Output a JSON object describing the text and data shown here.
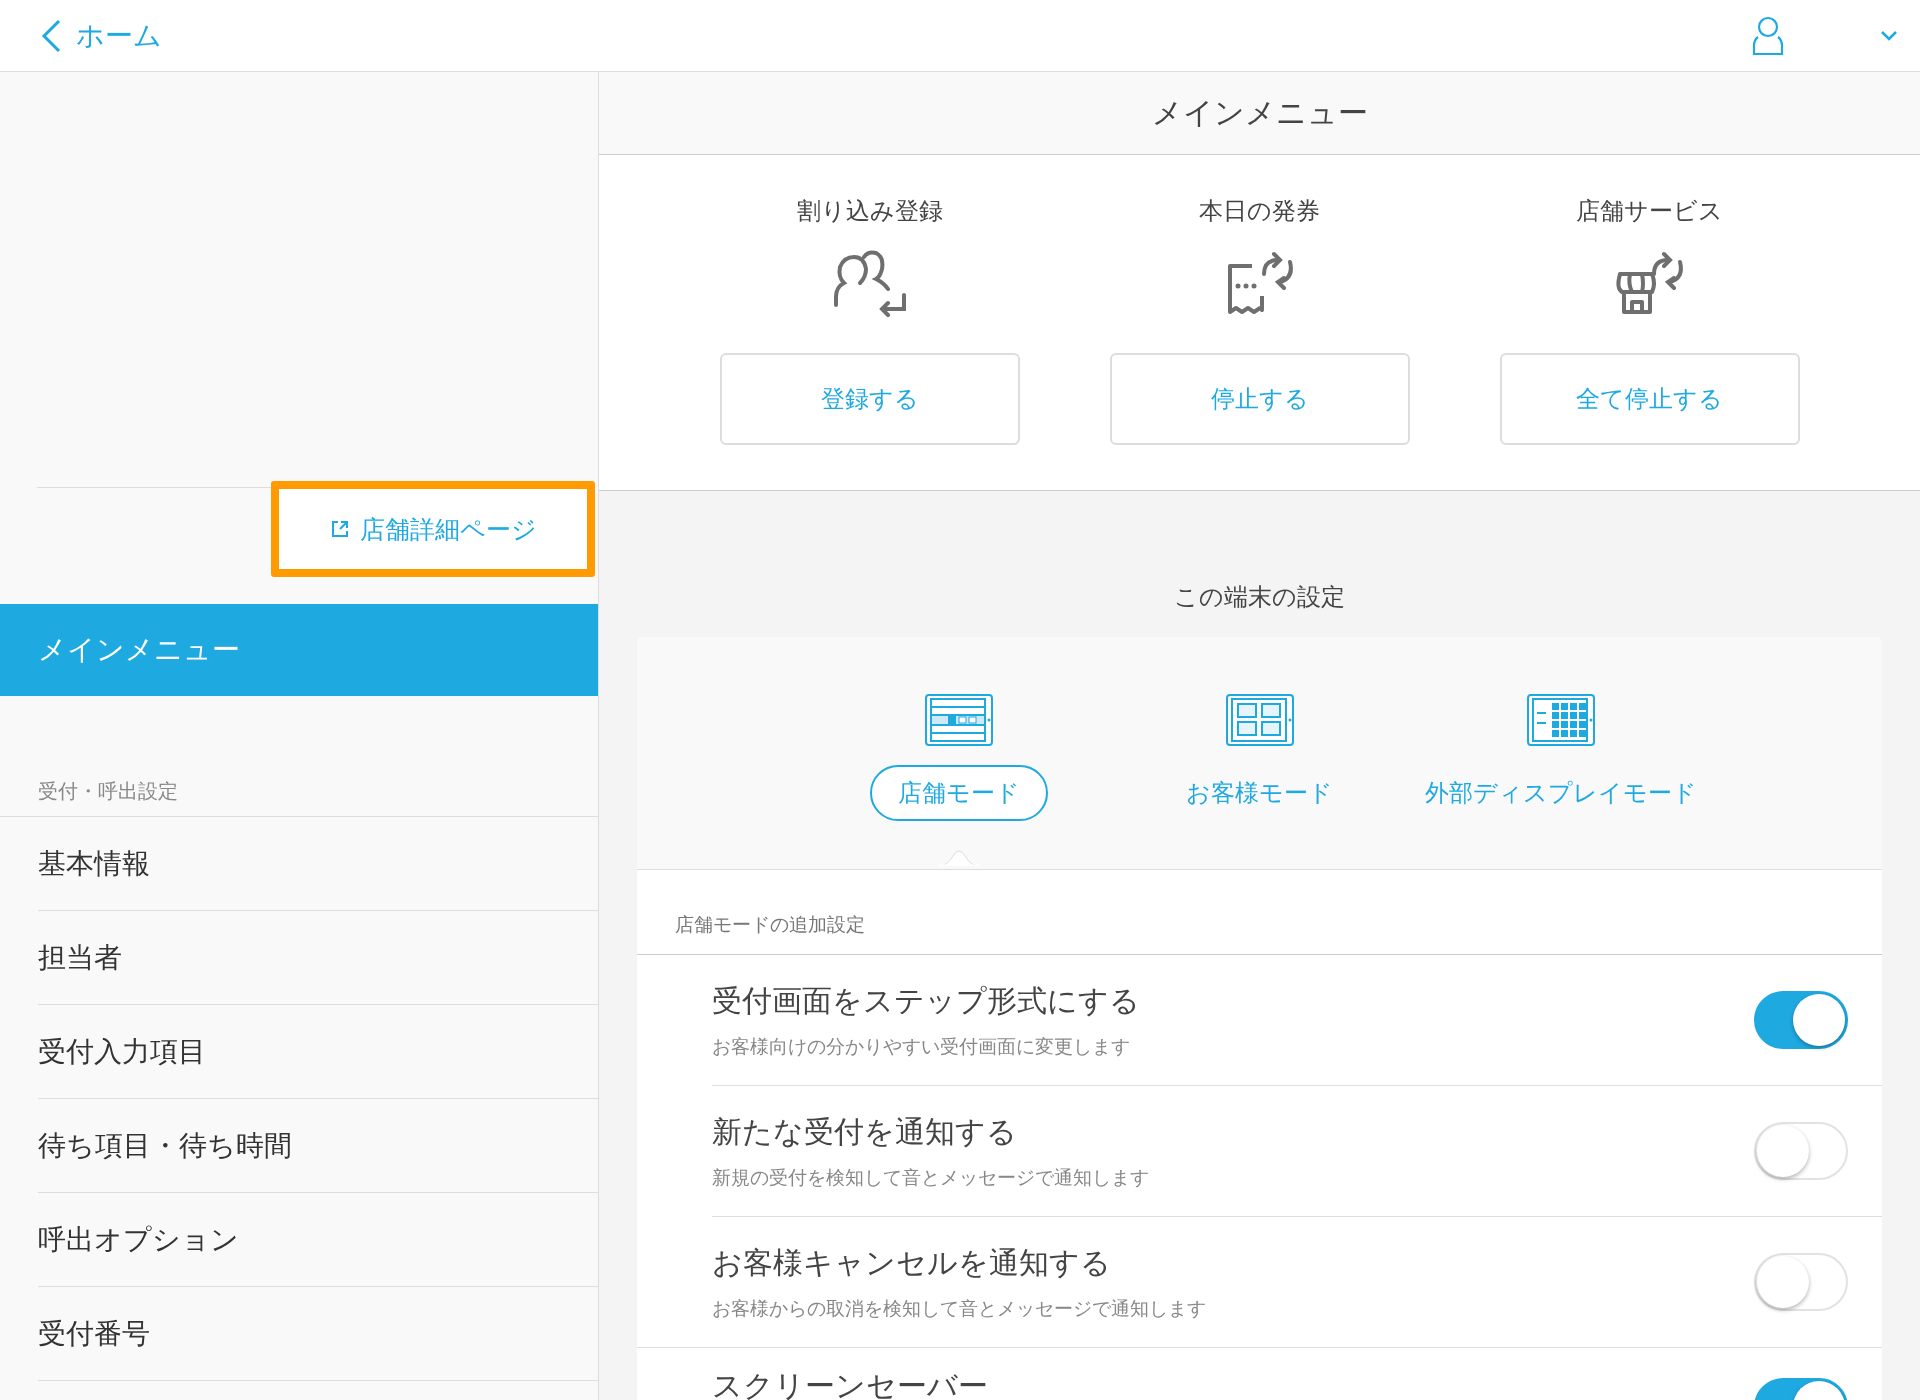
{
  "top_bar": {
    "back_label": "ホーム"
  },
  "sidebar": {
    "store_link": "店舗詳細ページ",
    "items": [
      {
        "label": "メインメニュー",
        "selected": true
      }
    ],
    "section_title": "受付・呼出設定",
    "section_items": [
      {
        "label": "基本情報",
        "selected": false
      },
      {
        "label": "担当者",
        "selected": false
      },
      {
        "label": "受付入力項目",
        "selected": false
      },
      {
        "label": "待ち項目・待ち時間",
        "selected": false
      },
      {
        "label": "呼出オプション",
        "selected": false
      },
      {
        "label": "受付番号",
        "selected": false
      }
    ]
  },
  "main_menu": {
    "title": "メインメニュー",
    "actions": [
      {
        "kind": "interrupt",
        "label": "割り込み登録",
        "button": "登録する"
      },
      {
        "kind": "ticket",
        "label": "本日の発券",
        "button": "停止する"
      },
      {
        "kind": "store",
        "label": "店舗サービス",
        "button": "全て停止する"
      }
    ]
  },
  "device_settings": {
    "title": "この端末の設定",
    "modes": [
      {
        "kind": "store",
        "label": "店舗モード",
        "selected": true
      },
      {
        "kind": "customer",
        "label": "お客様モード",
        "selected": false
      },
      {
        "kind": "display",
        "label": "外部ディスプレイモード",
        "selected": false
      }
    ],
    "extra_title": "店舗モードの追加設定",
    "toggles": [
      {
        "title": "受付画面をステップ形式にする",
        "description": "お客様向けの分かりやすい受付画面に変更します",
        "on": true
      },
      {
        "title": "新たな受付を通知する",
        "description": "新規の受付を検知して音とメッセージで通知します",
        "on": false
      },
      {
        "title": "お客様キャンセルを通知する",
        "description": "お客様からの取消を検知して音とメッセージで通知します",
        "on": false
      },
      {
        "title": "スクリーンセーバー",
        "on": true
      }
    ]
  }
}
